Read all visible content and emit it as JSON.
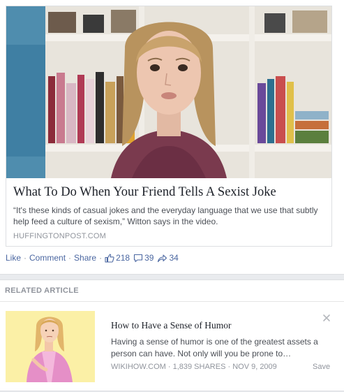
{
  "post": {
    "link": {
      "title": "What To Do When Your Friend Tells A Sexist Joke",
      "description": "“It's these kinds of casual jokes and the everyday language that we use that subtly help feed a culture of sexism,” Witton says in the video.",
      "domain": "HUFFINGTONPOST.COM"
    },
    "actions": {
      "like": "Like",
      "comment": "Comment",
      "share": "Share",
      "separator": "·"
    },
    "stats": {
      "likes": "218",
      "comments": "39",
      "shares": "34"
    },
    "icons": [
      "thumbs-up-icon",
      "comment-icon",
      "share-icon"
    ]
  },
  "related": {
    "header": "RELATED ARTICLE",
    "title": "How to Have a Sense of Humor",
    "description": "Having a sense of humor is one of the greatest assets a person can have. Not only will you be prone to…",
    "meta": "WIKIHOW.COM · 1,839 SHARES · NOV 9, 2009",
    "save": "Save",
    "close_icon": "close-icon"
  },
  "colors": {
    "link_blue": "#4b67a1",
    "muted_gray": "#90949c",
    "text_dark": "#1d2129",
    "background": "#e9ebee"
  }
}
